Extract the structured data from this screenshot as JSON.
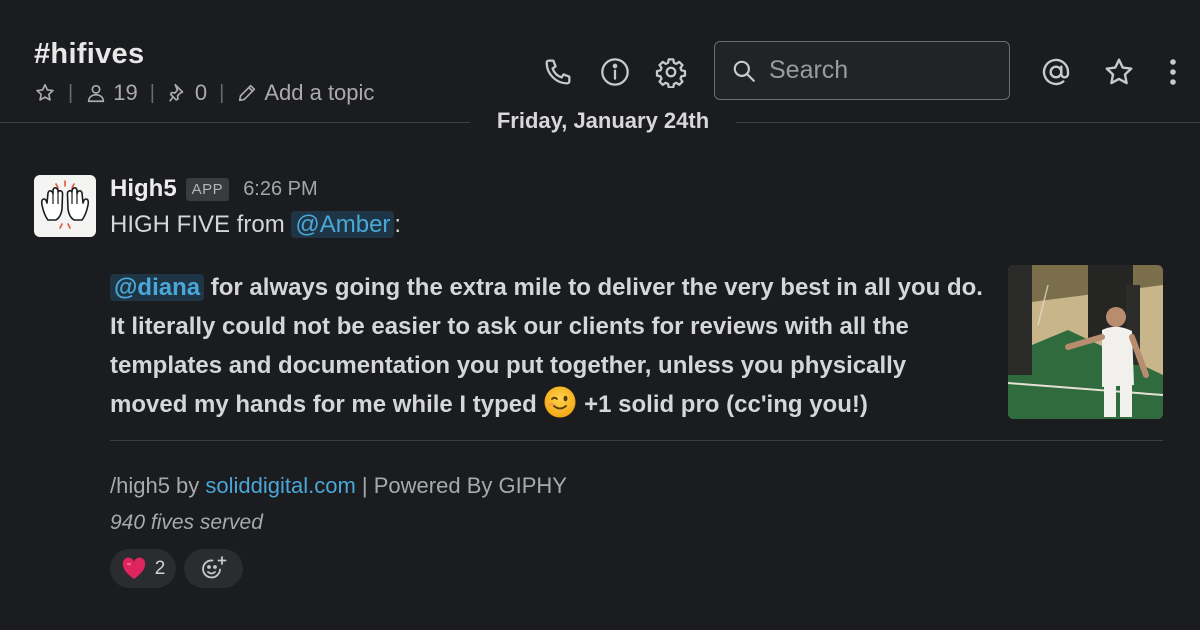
{
  "header": {
    "channel": "#hifives",
    "members_count": "19",
    "pins_count": "0",
    "topic_label": "Add a topic",
    "search_placeholder": "Search"
  },
  "date_divider": "Friday, January 24th",
  "message": {
    "sender": "High5",
    "badge": "APP",
    "time": "6:26 PM",
    "intro_prefix": "HIGH FIVE from ",
    "intro_mention": "@Amber",
    "intro_suffix": ":",
    "body_mention": "@diana",
    "body_text": " for always going the extra mile to deliver the very best in all you do. It literally could not be easier to ask our clients for reviews with all the templates and documentation you put together, unless you physically moved my hands for me while I typed ",
    "body_tail": " +1 solid pro (cc'ing you!)",
    "footer_command": "/high5 by ",
    "footer_link": "soliddigital.com",
    "footer_suffix": " | Powered By GIPHY",
    "fives_served": "940 fives served"
  },
  "reactions": [
    {
      "emoji": "heart-icon",
      "count": "2"
    }
  ],
  "icons": {
    "phone": "phone-icon",
    "info": "info-icon",
    "settings": "gear-icon",
    "mentions": "at-icon",
    "star": "star-icon",
    "more": "more-vertical-icon"
  },
  "colors": {
    "background": "#1b1c1f",
    "link": "#4aa7d8",
    "mention_bg": "#1d3545",
    "heart": "#e0245e"
  }
}
